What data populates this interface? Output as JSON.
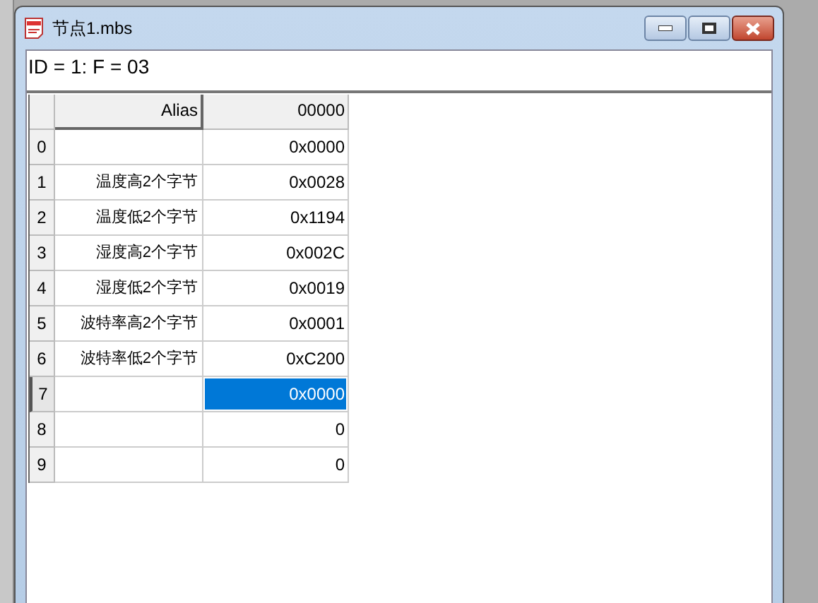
{
  "window": {
    "title": "节点1.mbs"
  },
  "info_line": "ID = 1: F = 03",
  "table": {
    "columns": [
      "Alias",
      "00000"
    ],
    "rows": [
      {
        "index": "0",
        "alias": "",
        "value": "0x0000",
        "selected": false
      },
      {
        "index": "1",
        "alias": "温度高2个字节",
        "value": "0x0028",
        "selected": false
      },
      {
        "index": "2",
        "alias": "温度低2个字节",
        "value": "0x1194",
        "selected": false
      },
      {
        "index": "3",
        "alias": "湿度高2个字节",
        "value": "0x002C",
        "selected": false
      },
      {
        "index": "4",
        "alias": "湿度低2个字节",
        "value": "0x0019",
        "selected": false
      },
      {
        "index": "5",
        "alias": "波特率高2个字节",
        "value": "0x0001",
        "selected": false
      },
      {
        "index": "6",
        "alias": "波特率低2个字节",
        "value": "0xC200",
        "selected": false
      },
      {
        "index": "7",
        "alias": "",
        "value": "0x0000",
        "selected": true
      },
      {
        "index": "8",
        "alias": "",
        "value": "0",
        "selected": false
      },
      {
        "index": "9",
        "alias": "",
        "value": "0",
        "selected": false
      }
    ]
  }
}
